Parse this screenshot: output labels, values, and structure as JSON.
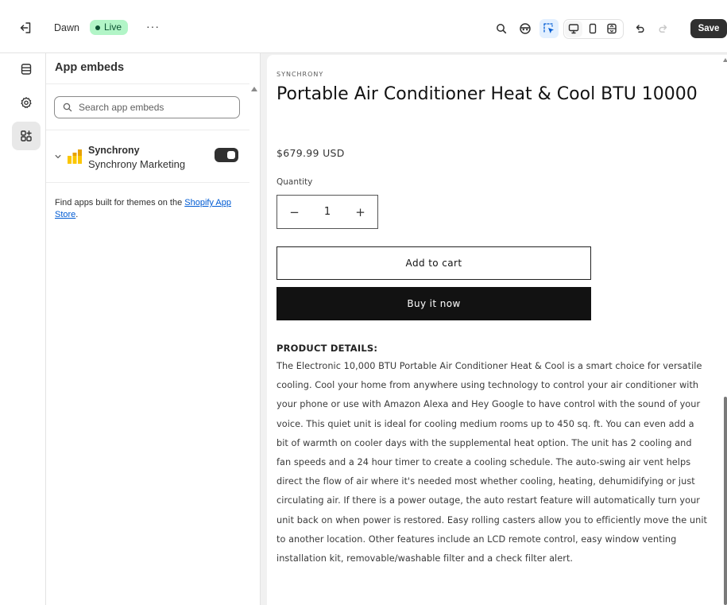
{
  "topbar": {
    "theme_name": "Dawn",
    "status_badge": "Live",
    "more_label": "···",
    "save_label": "Save"
  },
  "panel": {
    "title": "App embeds",
    "search_placeholder": "Search app embeds",
    "search_value": "",
    "embed": {
      "name": "Synchrony",
      "subtitle": "Synchrony Marketing",
      "enabled": true
    },
    "find_apps_text": "Find apps built for themes on the ",
    "find_apps_link": "Shopify App Store",
    "find_apps_end": "."
  },
  "product": {
    "vendor": "SYNCHRONY",
    "title": "Portable Air Conditioner Heat & Cool BTU 10000",
    "price": "$679.99 USD",
    "quantity_label": "Quantity",
    "quantity_value": "1",
    "minus_label": "−",
    "plus_label": "+",
    "add_to_cart_label": "Add to cart",
    "buy_now_label": "Buy it now",
    "details_heading": "PRODUCT DETAILS:",
    "details_body": "The Electronic 10,000 BTU Portable Air Conditioner Heat & Cool is a smart choice for versatile cooling. Cool your home from anywhere using technology to control your air conditioner with your phone or use with Amazon Alexa and Hey Google to have control with the sound of your voice. This quiet unit is ideal for cooling medium rooms up to 450 sq. ft. You can even add a bit of warmth on cooler days with the supplemental heat option. The unit has 2 cooling and fan speeds and a 24 hour timer to create a cooling schedule. The auto-swing air vent helps direct the flow of air where it's needed most whether cooling, heating, dehumidifying or just circulating air. If there is a power outage, the auto restart feature will automatically turn your unit back on when power is restored. Easy rolling casters allow you to efficiently move the unit to another location. Other features include an LCD remote control, easy window venting installation kit, removable/washable filter and a check filter alert."
  },
  "colors": {
    "accent_live": "#b2f5c7",
    "save_bg": "#303030",
    "link": "#005bd3",
    "buy_now_bg": "#121212",
    "inspector_active": "#e3f0ff"
  },
  "icons": {
    "exit": "exit-icon",
    "search": "search-icon",
    "ai": "sidekick-icon",
    "inspector": "inspector-icon",
    "desktop": "desktop-icon",
    "mobile": "mobile-icon",
    "fullscreen": "fullscreen-icon",
    "undo": "undo-icon",
    "redo": "redo-icon",
    "sections": "sections-icon",
    "settings": "gear-icon",
    "app_embeds": "apps-icon",
    "chevron": "chevron-down-icon",
    "embed_logo": "synchrony-logo-icon"
  }
}
